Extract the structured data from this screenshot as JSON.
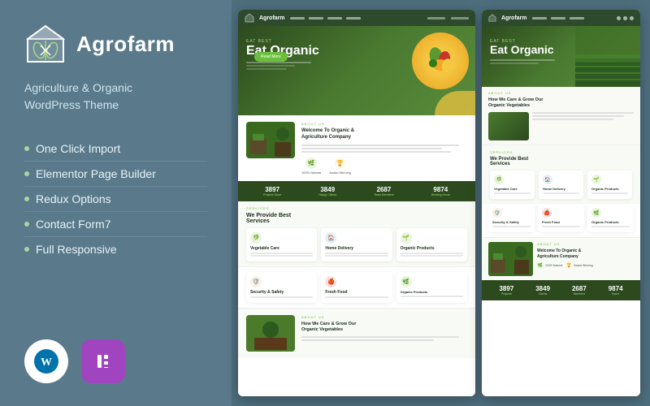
{
  "brand": {
    "name": "Agrofarm",
    "tagline_line1": "Agriculture & Organic",
    "tagline_line2": "WordPress Theme"
  },
  "features": [
    {
      "label": "One Click Import"
    },
    {
      "label": "Elementor Page Builder"
    },
    {
      "label": "Redux Options"
    },
    {
      "label": "Contact Form7"
    },
    {
      "label": "Full Responsive"
    }
  ],
  "badges": [
    {
      "name": "wordpress-badge",
      "label": "WP"
    },
    {
      "name": "elementor-badge",
      "label": "E"
    }
  ],
  "preview1": {
    "hero_small": "Eat Best",
    "hero_big": "Eat Organic",
    "section1_label": "About Us",
    "section1_title": "Welcome To Organic &\nAgriculture Company",
    "icon_features": [
      {
        "icon": "🌿",
        "label": "100% Natural",
        "color": "#e8f5e0"
      },
      {
        "icon": "🏆",
        "label": "Award Winning",
        "color": "#fff8e0"
      }
    ],
    "stats": [
      {
        "number": "3897",
        "label": "Projects Done"
      },
      {
        "number": "3849",
        "label": "Happy Clients"
      },
      {
        "number": "2687",
        "label": "Team Members"
      },
      {
        "number": "9874",
        "label": "Working Hours"
      }
    ],
    "services_label": "Services",
    "services_title": "We Provide Best\nServices",
    "services": [
      {
        "icon": "🥬",
        "title": "Vegetable Care",
        "color": "#e8f5e0"
      },
      {
        "icon": "🏠",
        "title": "Home Delivery",
        "color": "#e0f0ff"
      },
      {
        "icon": "🛡️",
        "title": "Security & Safety",
        "color": "#fff0e0"
      },
      {
        "icon": "🍎",
        "title": "Fresh Food",
        "color": "#ffe0e0"
      },
      {
        "icon": "🌱",
        "title": "Organic Products",
        "color": "#e8f5e0"
      }
    ],
    "about2_label": "About Us",
    "about2_title": "How We Care & Grow Our\nOrganic Vegetables"
  },
  "preview2": {
    "hero_small": "Eat Best",
    "hero_big": "Eat Organic",
    "services_label": "Services",
    "services_title": "We Provide Best\nServices",
    "services": [
      {
        "icon": "🥬",
        "title": "Vegetable Care",
        "color": "#e8f5e0"
      },
      {
        "icon": "🏠",
        "title": "Home Delivery",
        "color": "#e0f0ff"
      },
      {
        "icon": "🛡️",
        "title": "Security & Safety",
        "color": "#fff0e0"
      },
      {
        "icon": "🍎",
        "title": "Fresh Food",
        "color": "#ffe0e0"
      },
      {
        "icon": "🌱",
        "title": "Organic Products",
        "color": "#e8f5e0"
      }
    ],
    "about_label": "About Us",
    "about_title": "How We Care & Grow Our\nOrganic Vegetables",
    "about2_label": "About Us",
    "about2_title": "Welcome To Organic &\nAgriculture Company",
    "stats": [
      {
        "number": "3897",
        "label": "Projects"
      },
      {
        "number": "3849",
        "label": "Clients"
      },
      {
        "number": "2687",
        "label": "Members"
      },
      {
        "number": "9874",
        "label": "Hours"
      }
    ]
  },
  "colors": {
    "brand_green": "#6abf3a",
    "dark_green": "#2d4a1e",
    "left_bg": "#5a7a8c",
    "preview_bg": "#4e6e7e",
    "elementor_purple": "#a044c0"
  }
}
